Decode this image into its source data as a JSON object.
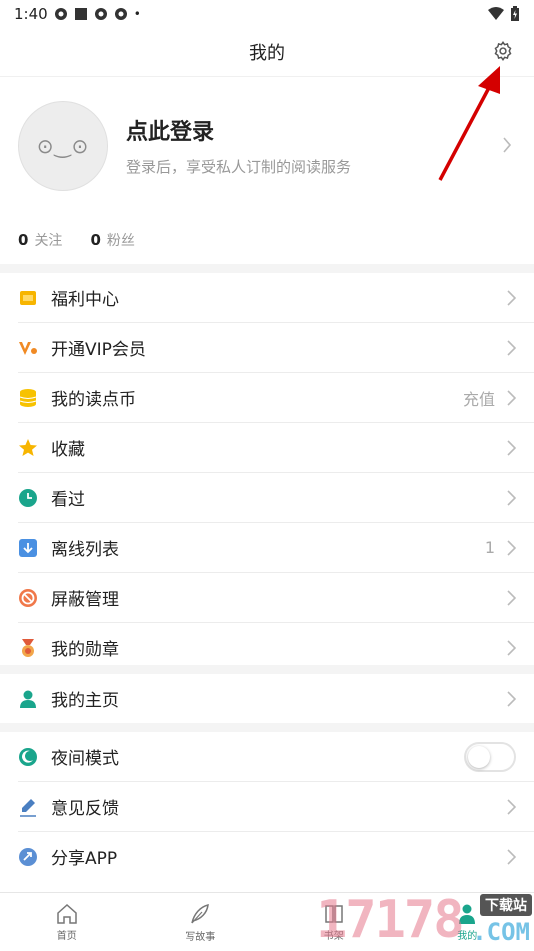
{
  "status_bar": {
    "time": "1:40",
    "dot": "•"
  },
  "header": {
    "title": "我的"
  },
  "profile": {
    "avatar_face": "⊙‿⊙",
    "login_title": "点此登录",
    "login_subtitle": "登录后，享受私人订制的阅读服务",
    "following_count": "0",
    "following_label": "关注",
    "fans_count": "0",
    "fans_label": "粉丝"
  },
  "menu_group1": [
    {
      "label": "福利中心",
      "icon": "gift-icon",
      "value": ""
    },
    {
      "label": "开通VIP会员",
      "icon": "vip-icon",
      "value": ""
    },
    {
      "label": "我的读点币",
      "icon": "coins-icon",
      "value": "充值"
    },
    {
      "label": "收藏",
      "icon": "star-icon",
      "value": ""
    },
    {
      "label": "看过",
      "icon": "clock-icon",
      "value": ""
    },
    {
      "label": "离线列表",
      "icon": "download-icon",
      "value": "1"
    },
    {
      "label": "屏蔽管理",
      "icon": "block-icon",
      "value": ""
    },
    {
      "label": "我的勋章",
      "icon": "medal-icon",
      "value": ""
    }
  ],
  "menu_group2": [
    {
      "label": "我的主页",
      "icon": "person-icon"
    }
  ],
  "menu_group3": [
    {
      "label": "夜间模式",
      "icon": "moon-icon",
      "toggle": false
    },
    {
      "label": "意见反馈",
      "icon": "pen-icon"
    },
    {
      "label": "分享APP",
      "icon": "share-icon"
    }
  ],
  "tabs": [
    {
      "label": "首页",
      "icon": "home-icon"
    },
    {
      "label": "写故事",
      "icon": "feather-icon"
    },
    {
      "label": "书架",
      "icon": "bookshelf-icon"
    },
    {
      "label": "我的",
      "icon": "me-icon"
    }
  ],
  "watermark": {
    "number": "17178",
    "top_text": "下载站",
    "domain": ".COM"
  },
  "colors": {
    "accent": "#1aa58c",
    "arrow": "#d40000"
  }
}
